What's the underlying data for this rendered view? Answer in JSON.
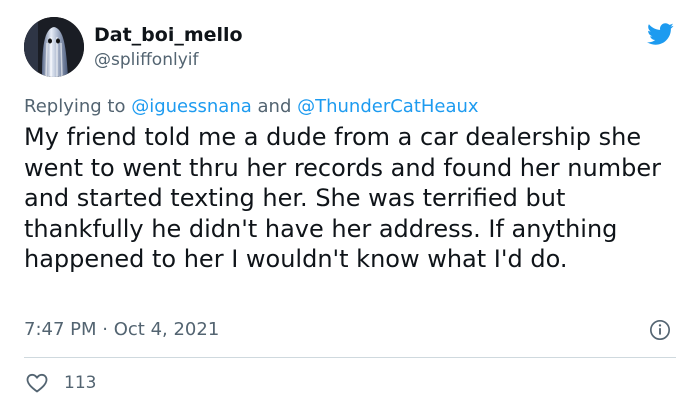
{
  "author": {
    "display_name": "Dat_boi_mello",
    "handle": "@spliffonlyif",
    "avatar_icon": "ghost-avatar"
  },
  "brand": {
    "icon": "twitter-bird-icon",
    "color": "#1d9bf0"
  },
  "reply": {
    "prefix": "Replying to",
    "mention_1": "@iguessnana",
    "joiner": "and",
    "mention_2": "@ThunderCatHeaux"
  },
  "tweet": {
    "text": "My friend told me a dude from a car dealership she went to went thru her records and found her number and started texting her. She was terrified but thankfully he didn't have her address. If anything happened to her I wouldn't know what I'd do.",
    "time": "7:47 PM",
    "separator": "·",
    "date": "Oct 4, 2021",
    "info_icon": "info-icon"
  },
  "engagement": {
    "like_icon": "heart-icon",
    "likes": "113"
  }
}
